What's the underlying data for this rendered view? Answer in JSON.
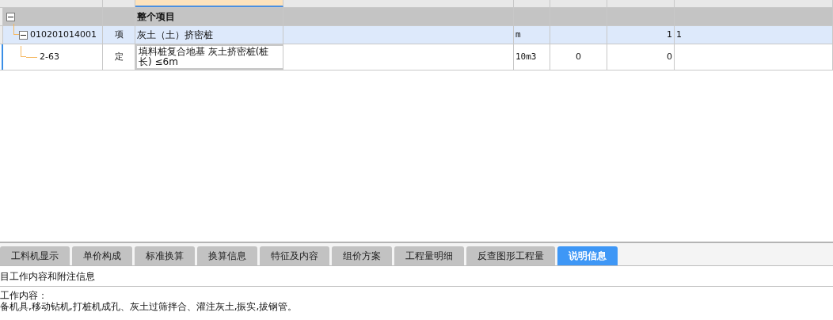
{
  "grid": {
    "columns": [
      {
        "selected": false
      },
      {
        "selected": false
      },
      {
        "selected": true
      },
      {
        "selected": false
      },
      {
        "selected": false
      },
      {
        "selected": false
      },
      {
        "selected": false
      },
      {
        "selected": false
      }
    ],
    "rows": [
      {
        "kind": "section",
        "name": "整个项目",
        "expanded": true,
        "selected": false,
        "children": [
          {
            "kind": "item",
            "code": "010201014001",
            "type": "项",
            "name": "灰土（土）挤密桩",
            "unit": "m",
            "quantity": "1",
            "quantity_expr": "1",
            "expanded": true,
            "selected": false,
            "children": [
              {
                "kind": "quota",
                "code": "2-63",
                "type": "定",
                "name": "填料桩复合地基 灰土挤密桩(桩长) ≤6m",
                "unit": "10m3",
                "content": "0",
                "quantity": "0",
                "selected": true
              }
            ]
          }
        ]
      }
    ]
  },
  "tabs": [
    {
      "label": "工料机显示",
      "selected": false
    },
    {
      "label": "单价构成",
      "selected": false
    },
    {
      "label": "标准换算",
      "selected": false
    },
    {
      "label": "换算信息",
      "selected": false
    },
    {
      "label": "特征及内容",
      "selected": false
    },
    {
      "label": "组价方案",
      "selected": false
    },
    {
      "label": "工程量明细",
      "selected": false
    },
    {
      "label": "反查图形工程量",
      "selected": false
    },
    {
      "label": "说明信息",
      "selected": true
    }
  ],
  "panel": {
    "title": "目工作内容和附注信息",
    "heading": "工作内容：",
    "body": "备机具,移动钻机,打桩机成孔、灰土过筛拌合、灌注灰土,振实,拔钢管。"
  }
}
